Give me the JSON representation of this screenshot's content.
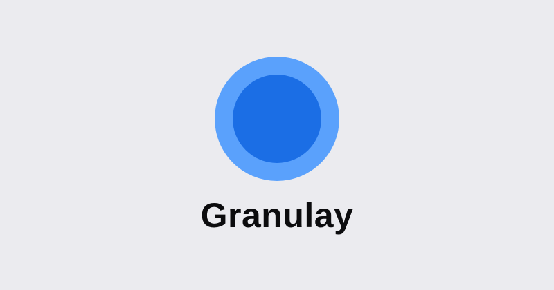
{
  "app": {
    "name": "Granulay"
  },
  "logo": {
    "icon": "circle-logo-icon",
    "outer_color": "#5aa1fc",
    "inner_color": "#1b6ee5"
  },
  "colors": {
    "background": "#ebebef",
    "text": "#0c0c0e"
  }
}
